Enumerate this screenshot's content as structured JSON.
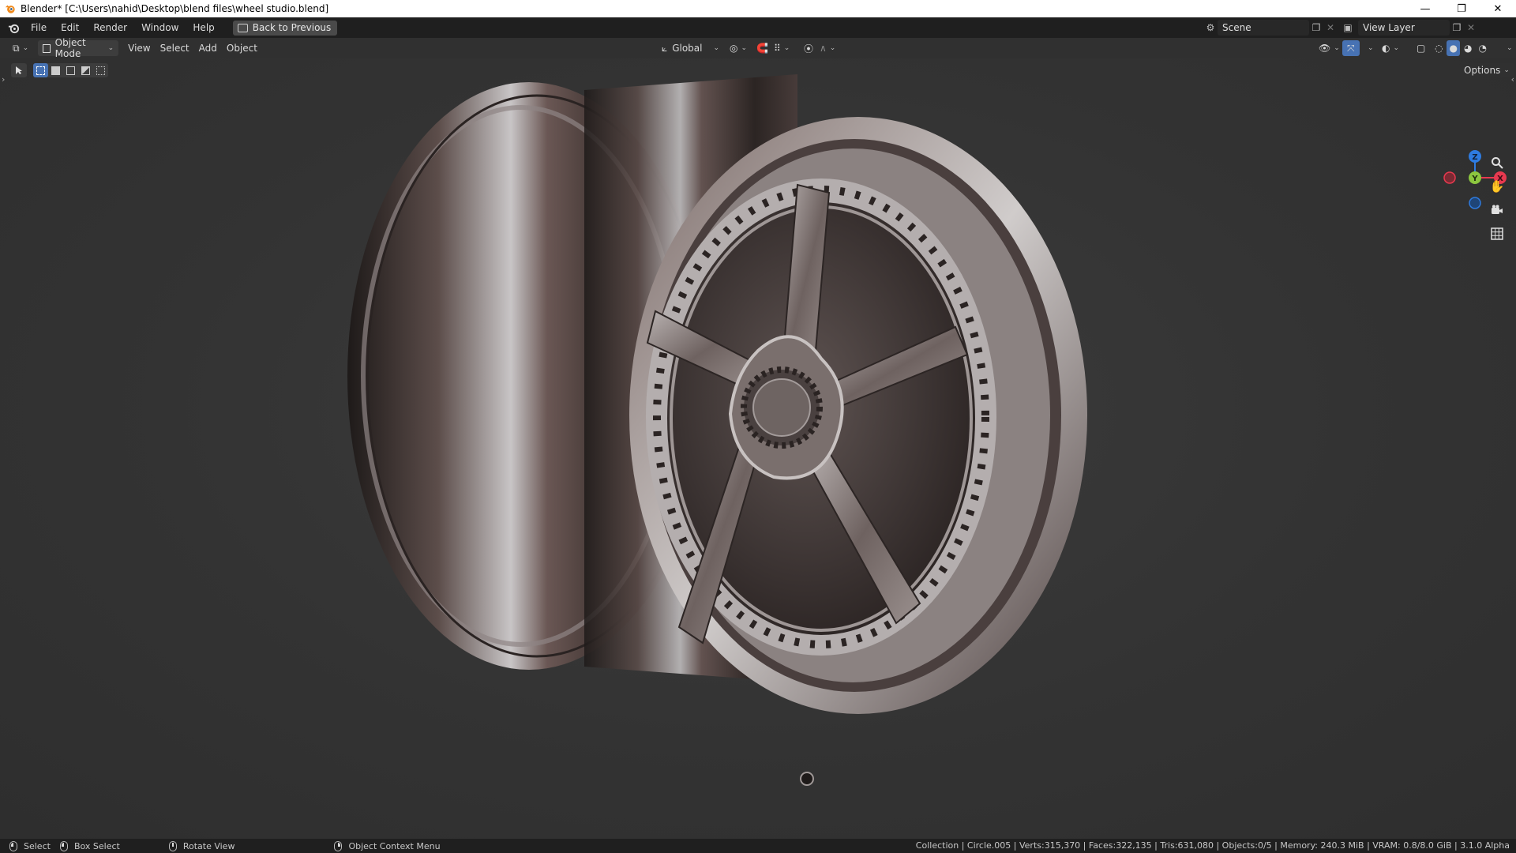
{
  "window": {
    "title": "Blender* [C:\\Users\\nahid\\Desktop\\blend files\\wheel studio.blend]",
    "controls": [
      "—",
      "❐",
      "✕"
    ]
  },
  "menu": {
    "items": [
      "File",
      "Edit",
      "Render",
      "Window",
      "Help"
    ],
    "back_button": "Back to Previous"
  },
  "scene": {
    "name": "Scene"
  },
  "view_layer": {
    "name": "View Layer"
  },
  "viewport_header": {
    "mode": "Object Mode",
    "menus": [
      "View",
      "Select",
      "Add",
      "Object"
    ],
    "orientation": "Global",
    "options": "Options"
  },
  "gizmo": {
    "z": "Z",
    "y": "Y",
    "x": "X",
    "colors": {
      "x": "#e8394f",
      "y": "#8cc63f",
      "z": "#2e7be0"
    }
  },
  "statusbar": {
    "select": "Select",
    "box_select": "Box Select",
    "rotate_view": "Rotate View",
    "context_menu": "Object Context Menu",
    "stats": "Collection | Circle.005 | Verts:315,370 | Faces:322,135 | Tris:631,080 | Objects:0/5 | Memory: 240.3 MiB | VRAM: 0.8/8.0 GiB | 3.1.0 Alpha"
  },
  "colors": {
    "accent": "#4772b3",
    "topbar": "#1f1f1f",
    "viewport": "#303030"
  }
}
